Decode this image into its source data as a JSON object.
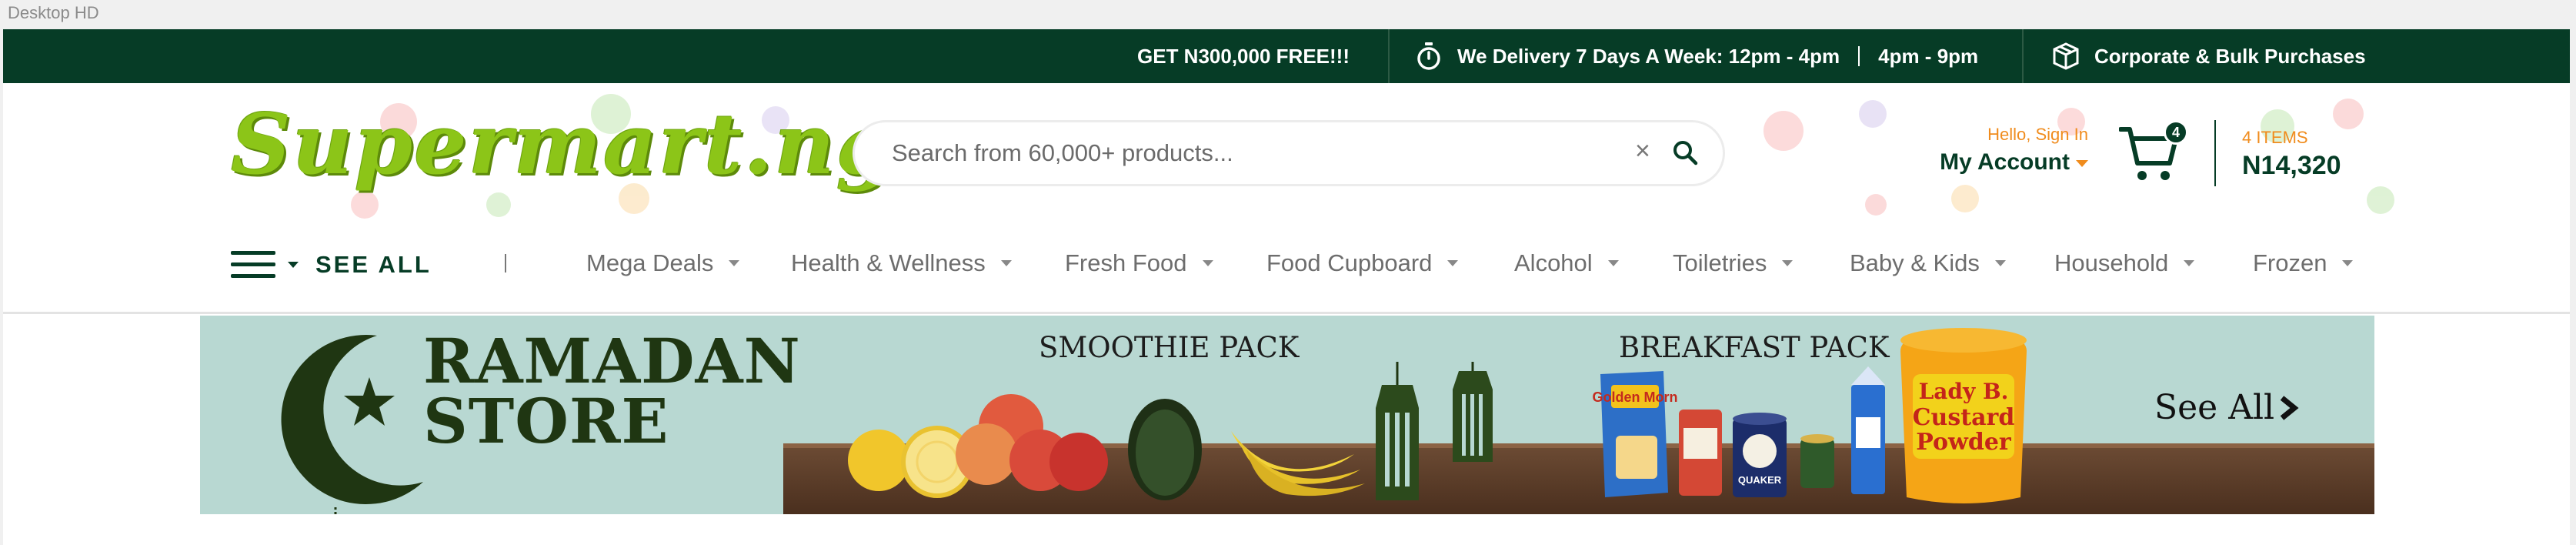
{
  "frame": {
    "label": "Desktop HD"
  },
  "topbar": {
    "promo": "GET N300,000 FREE!!!",
    "delivery_text": "We Delivery 7 Days A Week: 12pm - 4pm",
    "delivery_text_2": "4pm - 9pm",
    "corporate": "Corporate & Bulk Purchases",
    "icons": {
      "delivery": "stopwatch-icon",
      "corporate": "package-icon"
    },
    "bg_color": "#063c26"
  },
  "header": {
    "logo": "Supermart.ng",
    "search": {
      "placeholder": "Search from 60,000+ products...",
      "clear_glyph": "×"
    },
    "account": {
      "greeting": "Hello, Sign In",
      "label": "My Account"
    },
    "cart": {
      "count": "4",
      "items_label": "4 ITEMS",
      "total": "N14,320"
    },
    "accent_color": "#f08c1d",
    "logo_color": "#8cc518"
  },
  "nav": {
    "see_all": "SEE ALL",
    "separator": "|",
    "items": [
      {
        "label": "Mega Deals"
      },
      {
        "label": "Health & Wellness"
      },
      {
        "label": "Fresh Food"
      },
      {
        "label": "Food Cupboard"
      },
      {
        "label": "Alcohol"
      },
      {
        "label": "Toiletries"
      },
      {
        "label": "Baby & Kids"
      },
      {
        "label": "Household"
      },
      {
        "label": "Frozen"
      }
    ]
  },
  "banner": {
    "title_line1": "RAMADAN",
    "title_line2": "STORE",
    "pack1": "SMOOTHIE PACK",
    "pack2": "BREAKFAST PACK",
    "see_all": "See All",
    "product_labels": {
      "golden_morn": "Golden Morn",
      "quaker": "QUAKER",
      "custard_line1": "Lady B.",
      "custard_line2": "Custard",
      "custard_line3": "Powder"
    },
    "bg_color": "#b8d8d2"
  }
}
